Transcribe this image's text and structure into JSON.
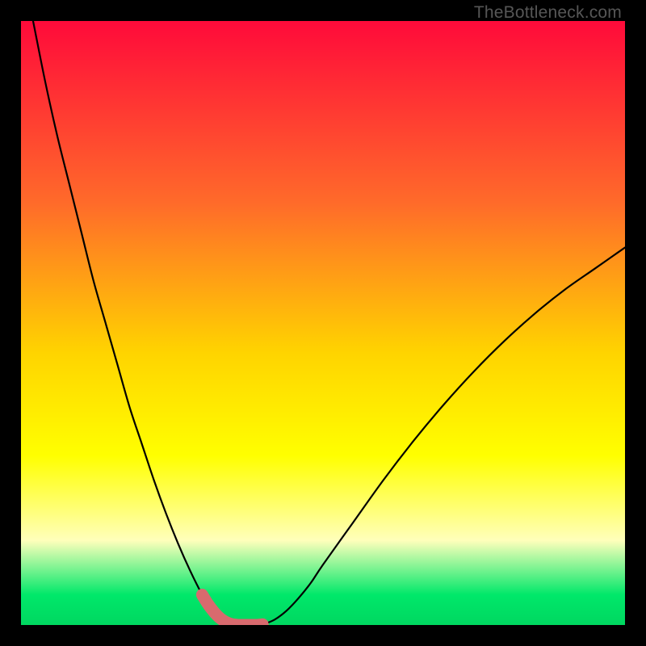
{
  "watermark": "TheBottleneck.com",
  "colors": {
    "bg_black": "#000000",
    "curve": "#000000",
    "highlight": "#d86a6e",
    "grad_top": "#ff0a3a",
    "grad_mid1": "#ff6a2a",
    "grad_mid2": "#ffd400",
    "grad_yellow": "#ffff00",
    "grad_pale_yellow": "#ffffbb",
    "grad_green": "#00e86a",
    "grad_green2": "#00d760"
  },
  "chart_data": {
    "type": "line",
    "title": "",
    "xlabel": "",
    "ylabel": "",
    "xlim": [
      0,
      100
    ],
    "ylim": [
      0,
      100
    ],
    "x": [
      0,
      2,
      4,
      6,
      8,
      10,
      12,
      14,
      16,
      18,
      20,
      22,
      24,
      26,
      28,
      30,
      31,
      32,
      33,
      34,
      35,
      36,
      37,
      38,
      39,
      40,
      42,
      44,
      46,
      48,
      50,
      55,
      60,
      65,
      70,
      75,
      80,
      85,
      90,
      95,
      100
    ],
    "y": [
      110,
      100,
      90,
      81,
      73,
      65,
      57,
      50,
      43,
      36,
      30,
      24,
      18.5,
      13.5,
      9,
      5,
      3.4,
      2.1,
      1.1,
      0.45,
      0.1,
      0,
      0,
      0,
      0,
      0.1,
      0.9,
      2.4,
      4.5,
      7,
      10,
      17,
      24,
      30.5,
      36.5,
      42,
      47,
      51.5,
      55.5,
      59,
      62.5
    ],
    "highlight_region": {
      "x_start": 30,
      "x_end": 40,
      "description": "points near the trough drawn with thick rounded pink stroke"
    },
    "background_gradient": {
      "direction": "vertical",
      "stops": [
        {
          "pos": 0.0,
          "color": "#ff0a3a"
        },
        {
          "pos": 0.3,
          "color": "#ff6a2a"
        },
        {
          "pos": 0.55,
          "color": "#ffd400"
        },
        {
          "pos": 0.72,
          "color": "#ffff00"
        },
        {
          "pos": 0.86,
          "color": "#ffffbb"
        },
        {
          "pos": 0.95,
          "color": "#00e86a"
        },
        {
          "pos": 1.0,
          "color": "#00d760"
        }
      ]
    }
  }
}
